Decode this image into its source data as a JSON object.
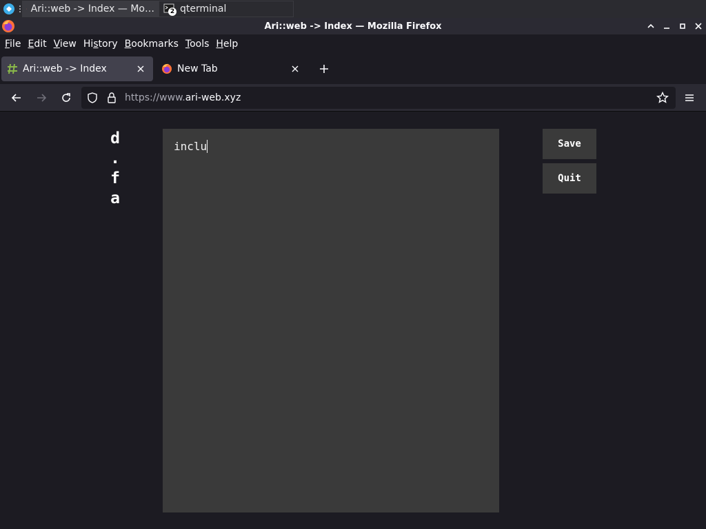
{
  "taskbar": {
    "tasks": [
      {
        "label": "Ari::web -> Index — Mo…",
        "active": true
      },
      {
        "label": "qterminal",
        "badge": "2",
        "active": false
      }
    ]
  },
  "window": {
    "title": "Ari::web -> Index — Mozilla Firefox"
  },
  "menu": {
    "items": [
      {
        "pre": "",
        "u": "F",
        "post": "ile"
      },
      {
        "pre": "",
        "u": "E",
        "post": "dit"
      },
      {
        "pre": "",
        "u": "V",
        "post": "iew"
      },
      {
        "pre": "Hi",
        "u": "s",
        "post": "tory"
      },
      {
        "pre": "",
        "u": "B",
        "post": "ookmarks"
      },
      {
        "pre": "",
        "u": "T",
        "post": "ools"
      },
      {
        "pre": "",
        "u": "H",
        "post": "elp"
      }
    ]
  },
  "tabs": [
    {
      "label": "Ari::web -> Index",
      "selected": true,
      "icon": "puzzle-hash-icon"
    },
    {
      "label": "New Tab",
      "selected": false,
      "icon": "firefox-icon"
    }
  ],
  "navbar": {
    "url_scheme": "https://www.",
    "url_host": "ari-web.xyz"
  },
  "page": {
    "filename_chars": [
      "d",
      ".",
      "f",
      "a"
    ],
    "editor_text": "inclu",
    "save_label": "Save",
    "quit_label": "Quit"
  },
  "colors": {
    "background": "#1c1b22",
    "toolbar": "#2b2a33",
    "selected_tab": "#42414d",
    "editor_bg": "#3a3a3a"
  }
}
